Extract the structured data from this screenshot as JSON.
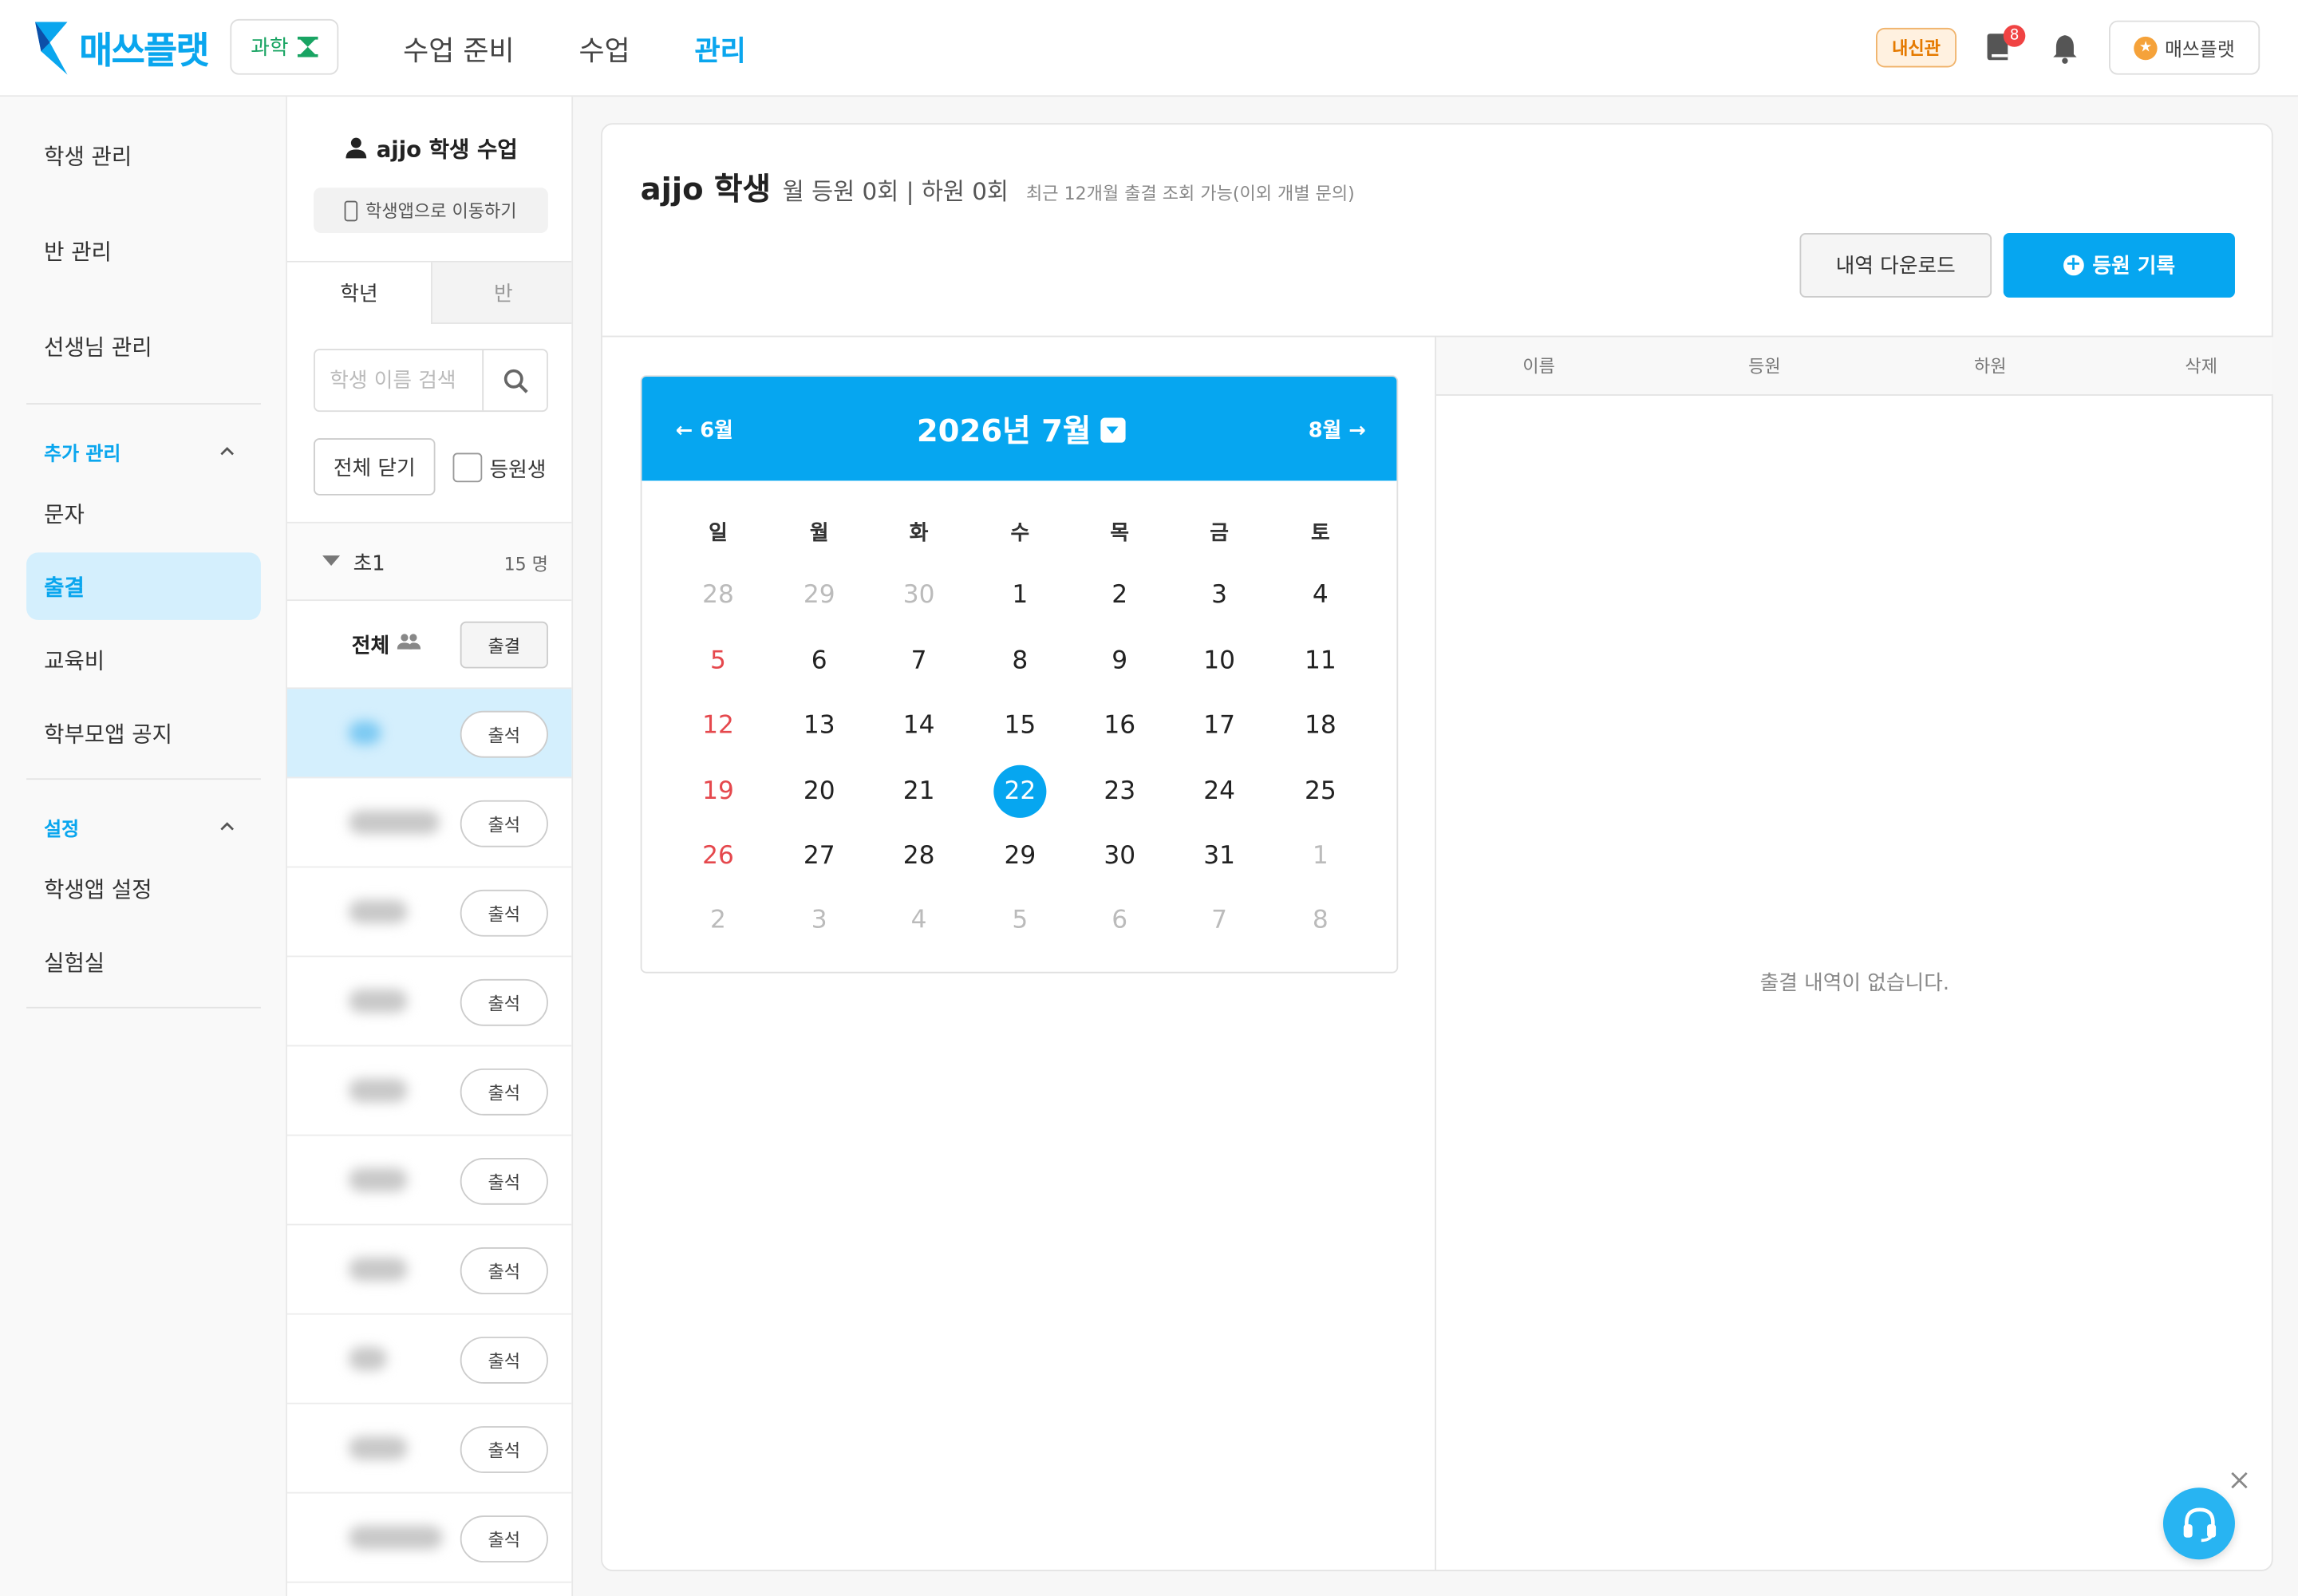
{
  "header": {
    "logo_text": "매쓰플랫",
    "subject": "과학",
    "nav": [
      "수업 준비",
      "수업",
      "관리"
    ],
    "naesin": "내신관",
    "book_badge": "8",
    "user_label": "매쓰플랫",
    "colors": {
      "brand": "#0aa6ee",
      "subject": "#19a463",
      "badge": "#f04343"
    }
  },
  "sidebar": {
    "items_top": [
      "학생 관리",
      "반 관리",
      "선생님 관리"
    ],
    "section_extra": "추가 관리",
    "items_extra": [
      "문자",
      "출결",
      "교육비",
      "학부모앱 공지"
    ],
    "section_settings": "설정",
    "items_settings": [
      "학생앱 설정",
      "실험실"
    ]
  },
  "student_panel": {
    "title": "ajjo 학생 수업",
    "app_link": "학생앱으로 이동하기",
    "tab_grade": "학년",
    "tab_class": "반",
    "search_placeholder": "학생 이름 검색",
    "close_all": "전체 닫기",
    "checkbox_label": "등원생",
    "group_name": "초1",
    "group_count": "15 명",
    "all_label": "전체",
    "all_button": "출결",
    "row_button": "출석"
  },
  "main": {
    "student_name": "ajjo 학생",
    "stats": "월 등원 0회 | 하원 0회",
    "note": "최근 12개월 출결 조회 가능(이외 개별 문의)",
    "download_button": "내역 다운로드",
    "record_button": "등원 기록"
  },
  "calendar": {
    "prev": "← 6월",
    "next": "8월 →",
    "title": "2026년 7월",
    "weekdays": [
      "일",
      "월",
      "화",
      "수",
      "목",
      "금",
      "토"
    ],
    "weeks": [
      [
        "28",
        "29",
        "30",
        "1",
        "2",
        "3",
        "4"
      ],
      [
        "5",
        "6",
        "7",
        "8",
        "9",
        "10",
        "11"
      ],
      [
        "12",
        "13",
        "14",
        "15",
        "16",
        "17",
        "18"
      ],
      [
        "19",
        "20",
        "21",
        "22",
        "23",
        "24",
        "25"
      ],
      [
        "26",
        "27",
        "28",
        "29",
        "30",
        "31",
        "1"
      ],
      [
        "2",
        "3",
        "4",
        "5",
        "6",
        "7",
        "8"
      ]
    ],
    "today": "22"
  },
  "table": {
    "columns": [
      "이름",
      "등원",
      "하원",
      "삭제"
    ],
    "empty_message": "출결 내역이 없습니다."
  }
}
